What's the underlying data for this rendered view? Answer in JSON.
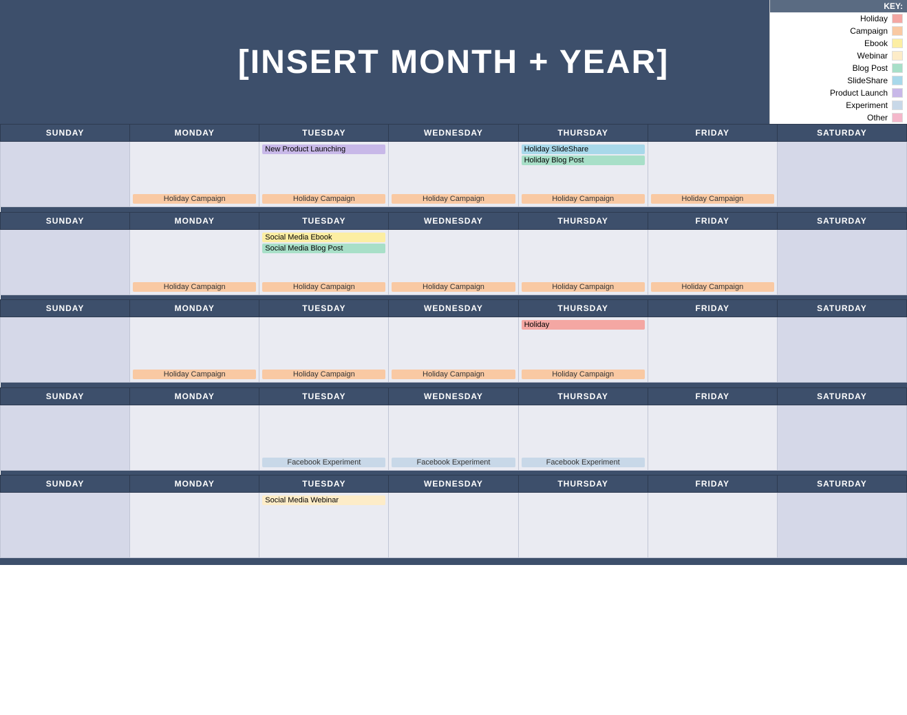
{
  "header": {
    "title": "[INSERT MONTH + YEAR]"
  },
  "legend": {
    "key_label": "KEY:",
    "items": [
      {
        "label": "Holiday",
        "color": "#f4a7a3"
      },
      {
        "label": "Campaign",
        "color": "#f9c9a3"
      },
      {
        "label": "Ebook",
        "color": "#fceea3"
      },
      {
        "label": "Webinar",
        "color": "#fdecc8"
      },
      {
        "label": "Blog Post",
        "color": "#a8dfc8"
      },
      {
        "label": "SlideShare",
        "color": "#a8d8ea"
      },
      {
        "label": "Product Launch",
        "color": "#c8b8e8"
      },
      {
        "label": "Experiment",
        "color": "#c8d8e8"
      },
      {
        "label": "Other",
        "color": "#f4b8cb"
      }
    ]
  },
  "days": [
    "SUNDAY",
    "MONDAY",
    "TUESDAY",
    "WEDNESDAY",
    "THURSDAY",
    "FRIDAY",
    "SATURDAY"
  ],
  "weeks": [
    {
      "cells": [
        {
          "events": [],
          "bottom": ""
        },
        {
          "events": [],
          "bottom": "Holiday Campaign"
        },
        {
          "events": [
            "New Product Launching"
          ],
          "event_types": [
            "ev-product"
          ],
          "bottom": "Holiday Campaign"
        },
        {
          "events": [],
          "bottom": "Holiday Campaign"
        },
        {
          "events": [
            "Holiday SlideShare",
            "Holiday Blog Post"
          ],
          "event_types": [
            "ev-slide",
            "ev-blog"
          ],
          "bottom": "Holiday Campaign"
        },
        {
          "events": [],
          "bottom": "Holiday Campaign"
        },
        {
          "events": [],
          "bottom": ""
        }
      ]
    },
    {
      "cells": [
        {
          "events": [],
          "bottom": ""
        },
        {
          "events": [],
          "bottom": "Holiday Campaign"
        },
        {
          "events": [
            "Social Media Ebook",
            "Social Media Blog Post"
          ],
          "event_types": [
            "ev-ebook",
            "ev-blog"
          ],
          "bottom": "Holiday Campaign"
        },
        {
          "events": [],
          "bottom": "Holiday Campaign"
        },
        {
          "events": [],
          "bottom": "Holiday Campaign"
        },
        {
          "events": [],
          "bottom": "Holiday Campaign"
        },
        {
          "events": [],
          "bottom": ""
        }
      ]
    },
    {
      "cells": [
        {
          "events": [],
          "bottom": ""
        },
        {
          "events": [],
          "bottom": "Holiday Campaign"
        },
        {
          "events": [],
          "bottom": "Holiday Campaign"
        },
        {
          "events": [],
          "bottom": "Holiday Campaign"
        },
        {
          "events": [
            "Holiday"
          ],
          "event_types": [
            "ev-holiday"
          ],
          "bottom": "Holiday Campaign"
        },
        {
          "events": [],
          "bottom": ""
        },
        {
          "events": [],
          "bottom": ""
        }
      ]
    },
    {
      "cells": [
        {
          "events": [],
          "bottom": ""
        },
        {
          "events": [],
          "bottom": ""
        },
        {
          "events": [],
          "bottom": "Facebook Experiment"
        },
        {
          "events": [],
          "bottom": "Facebook Experiment"
        },
        {
          "events": [],
          "bottom": "Facebook Experiment"
        },
        {
          "events": [],
          "bottom": ""
        },
        {
          "events": [],
          "bottom": ""
        }
      ]
    },
    {
      "cells": [
        {
          "events": [],
          "bottom": ""
        },
        {
          "events": [],
          "bottom": ""
        },
        {
          "events": [
            "Social Media Webinar"
          ],
          "event_types": [
            "ev-webinar"
          ],
          "bottom": ""
        },
        {
          "events": [],
          "bottom": ""
        },
        {
          "events": [],
          "bottom": ""
        },
        {
          "events": [],
          "bottom": ""
        },
        {
          "events": [],
          "bottom": ""
        }
      ]
    }
  ]
}
